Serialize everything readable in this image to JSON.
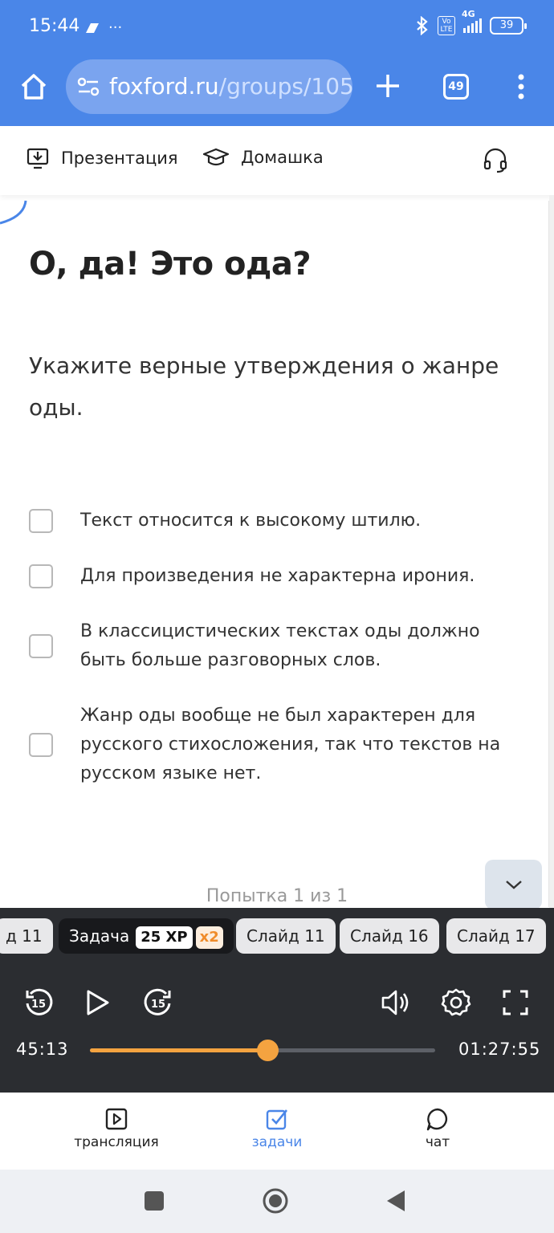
{
  "status_bar": {
    "time": "15:44",
    "more": "···",
    "network": "4G",
    "volte": "Vo LTE",
    "battery": "39"
  },
  "browser": {
    "url_domain": "foxford.ru",
    "url_path": "/groups/105",
    "tabs_count": "49"
  },
  "toolbar": {
    "presentation_label": "Презентация",
    "homework_label": "Домашка"
  },
  "task": {
    "title": "О, да! Это ода?",
    "question": "Укажите верные утверждения о жанре оды.",
    "options": [
      {
        "text": "Текст относится к высокому штилю.",
        "checked": false
      },
      {
        "text": "Для произведения не характерна ирония.",
        "checked": false
      },
      {
        "text": "В классицистических текстах оды должно быть больше разговорных слов.",
        "checked": false
      },
      {
        "text": "Жанр оды вообще не был характерен для русского стихосложения, так что текстов на русском языке нет.",
        "checked": false
      }
    ],
    "attempt": "Попытка 1 из 1"
  },
  "chips": {
    "partial_left": "д 11",
    "task_label": "Задача",
    "xp": "25 XP",
    "multiplier": "x2",
    "slide_a": "Слайд 11",
    "slide_b": "Слайд 16",
    "slide_c": "Слайд 17"
  },
  "player": {
    "current_time": "45:13",
    "total_time": "01:27:55",
    "progress": 0.516,
    "rewind_seconds": "15",
    "forward_seconds": "15"
  },
  "bottom_nav": {
    "stream": "трансляция",
    "tasks": "задачи",
    "chat": "чат"
  },
  "colors": {
    "brand_blue": "#4a86e8",
    "player_bg": "#2b2d31",
    "accent_orange": "#f4a340"
  }
}
